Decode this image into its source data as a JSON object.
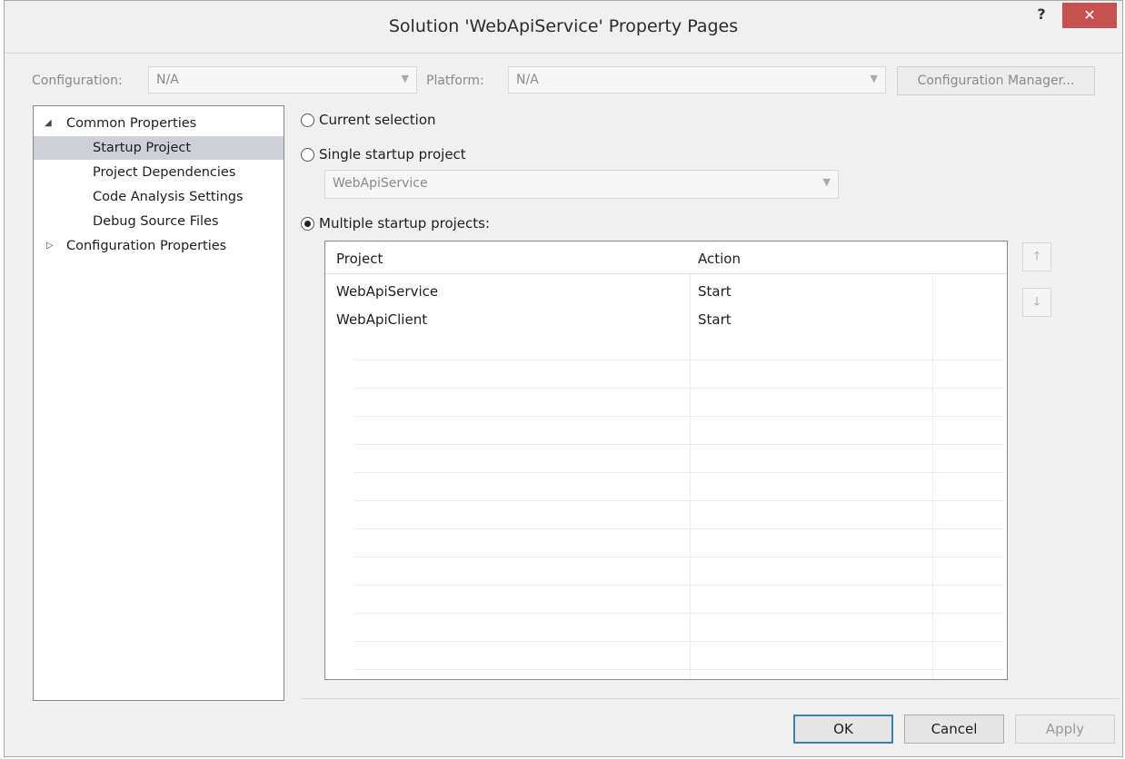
{
  "window": {
    "title": "Solution 'WebApiService' Property Pages",
    "help_label": "?",
    "close_label": "✕"
  },
  "toolbar": {
    "configuration_label": "Configuration:",
    "configuration_value": "N/A",
    "platform_label": "Platform:",
    "platform_value": "N/A",
    "config_manager_label": "Configuration Manager..."
  },
  "tree": {
    "common_properties": "Common Properties",
    "items": [
      "Startup Project",
      "Project Dependencies",
      "Code Analysis Settings",
      "Debug Source Files"
    ],
    "configuration_properties": "Configuration Properties",
    "selected": "Startup Project"
  },
  "startup": {
    "current_selection": "Current selection",
    "single_startup": "Single startup project",
    "single_value": "WebApiService",
    "multiple_startup": "Multiple startup projects:",
    "selected_option": "multiple"
  },
  "grid": {
    "columns": [
      "Project",
      "Action"
    ],
    "rows": [
      {
        "project": "WebApiService",
        "action": "Start"
      },
      {
        "project": "WebApiClient",
        "action": "Start"
      }
    ]
  },
  "buttons": {
    "ok": "OK",
    "cancel": "Cancel",
    "apply": "Apply"
  },
  "icons": {
    "move_up": "arrow-up-icon",
    "move_down": "arrow-down-icon"
  }
}
